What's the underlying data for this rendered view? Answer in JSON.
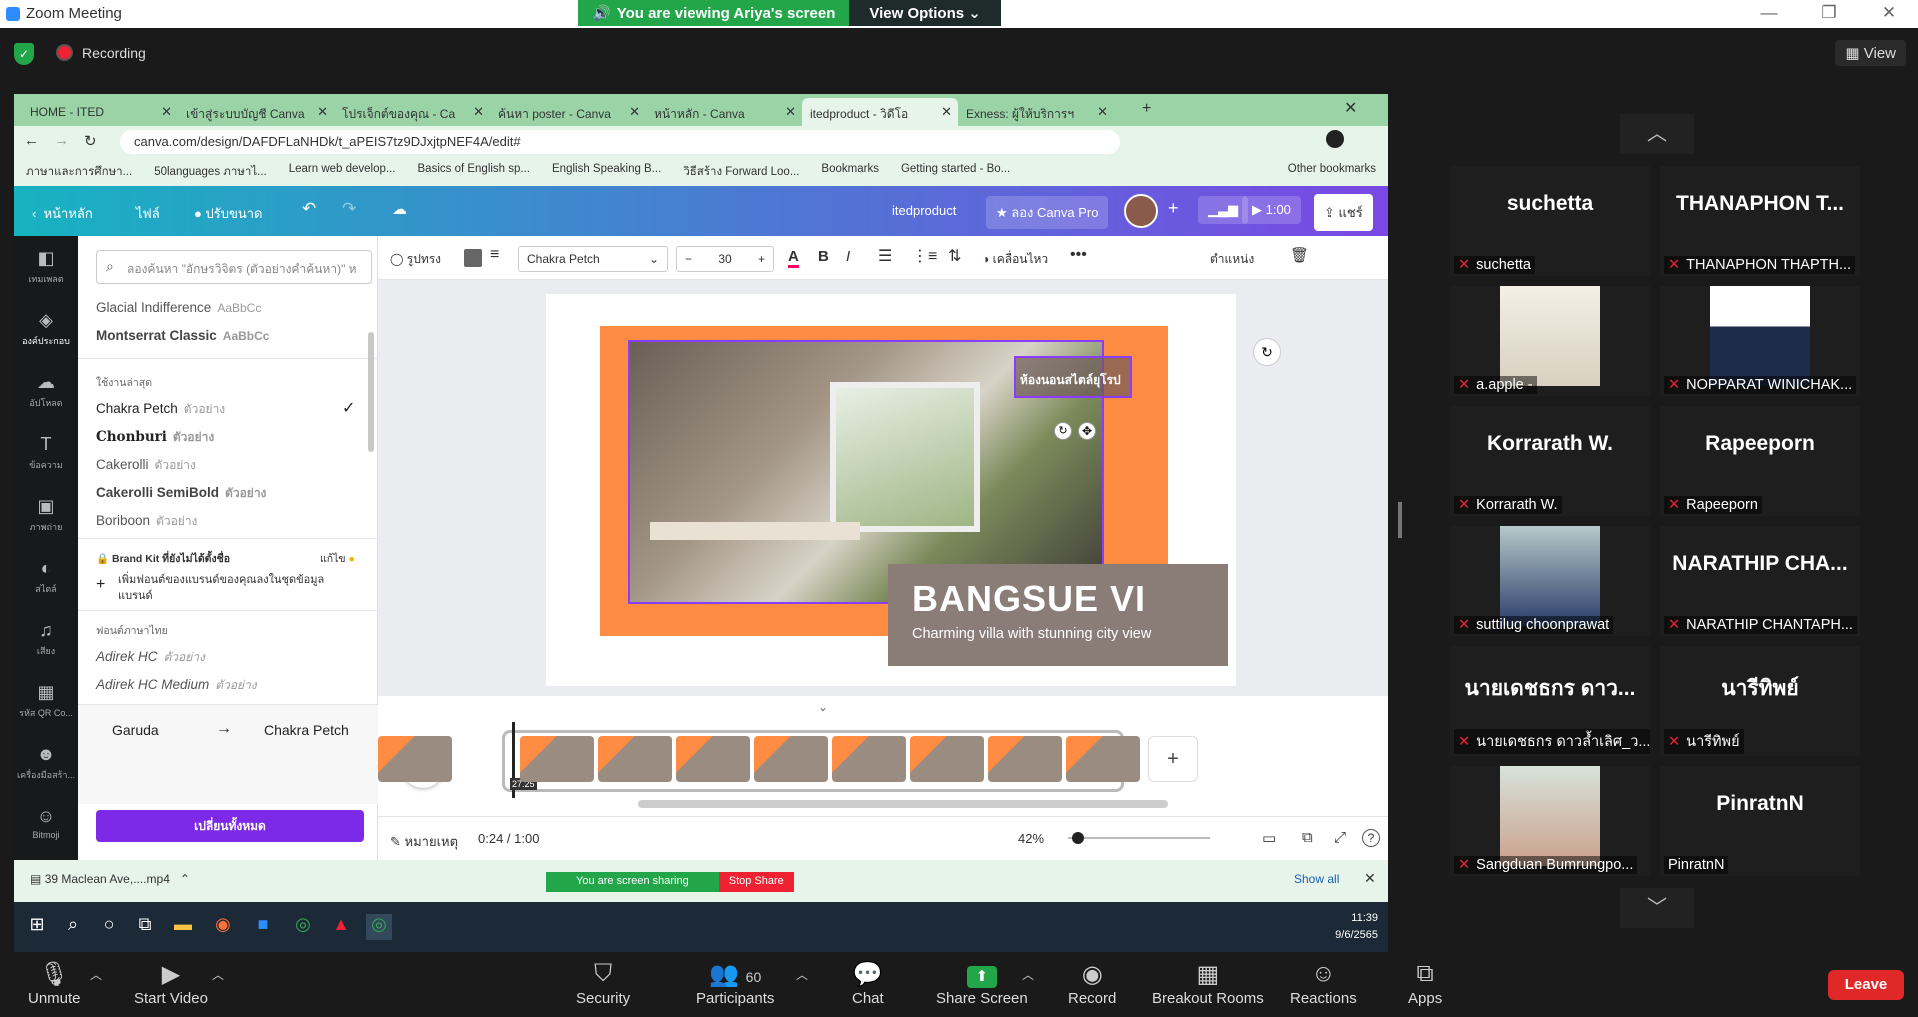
{
  "window": {
    "title": "Zoom Meeting"
  },
  "banner": {
    "viewing": "You are viewing Ariya's screen",
    "view_options": "View Options"
  },
  "meeting": {
    "recording": "Recording",
    "view": "View"
  },
  "browser": {
    "tabs": [
      "HOME - ITED",
      "เข้าสู่ระบบบัญชี Canva",
      "โปรเจ็กต์ของคุณ - Ca",
      "ค้นหา poster - Canva",
      "หน้าหลัก - Canva",
      "itedproduct - วิดีโอ",
      "Exness: ผู้ให้บริการฯ"
    ],
    "url": "canva.com/design/DAFDFLaNHDk/t_aPEIS7tz9DJxjtpNEF4A/edit#",
    "bookmarks": [
      "ภาษาและการศึกษา...",
      "50languages ภาษาไ...",
      "Learn web develop...",
      "Basics of English sp...",
      "English Speaking B...",
      "วิธีสร้าง Forward Loo...",
      "Bookmarks",
      "Getting started - Bo...",
      "Other bookmarks"
    ]
  },
  "canva": {
    "header": {
      "home": "หน้าหลัก",
      "file": "ไฟล์",
      "resize": "ปรับขนาด",
      "project": "itedproduct",
      "try_pro": "ลอง Canva Pro",
      "duration": "1:00",
      "share": "แชร์"
    },
    "rail": [
      "เทมเพลต",
      "องค์ประกอบ",
      "อัปโหลด",
      "ข้อความ",
      "ภาพถ่าย",
      "สไตล์",
      "เสียง",
      "รหัส QR Co...",
      "เครื่องมือสร้า...",
      "Bitmoji"
    ],
    "font_panel": {
      "search_placeholder": "ลองค้นหา \"อักษรวิจิตร (ตัวอย่างคำค้นหา)\" ห",
      "top_fonts": [
        {
          "name": "Glacial Indifference",
          "sample": "AaBbCc"
        },
        {
          "name": "Montserrat Classic",
          "sample": "AaBbCc"
        }
      ],
      "recent_label": "ใช้งานล่าสุด",
      "recent_fonts": [
        {
          "name": "Chakra Petch",
          "sample": "ตัวอย่าง"
        },
        {
          "name": "Chonburi",
          "sample": "ตัวอย่าง"
        },
        {
          "name": "Cakerolli",
          "sample": "ตัวอย่าง"
        },
        {
          "name": "Cakerolli SemiBold",
          "sample": "ตัวอย่าง"
        },
        {
          "name": "Boriboon",
          "sample": "ตัวอย่าง"
        }
      ],
      "brand_kit": "Brand Kit ที่ยังไม่ได้ตั้งชื่อ",
      "brand_edit": "แก้ไข",
      "brand_add": "เพิ่มฟอนต์ของแบรนด์ของคุณลงในชุดข้อมูลแบรนด์",
      "thai_label": "ฟอนต์ภาษาไทย",
      "thai_fonts": [
        {
          "name": "Adirek HC",
          "sample": "ตัวอย่าง"
        },
        {
          "name": "Adirek HC Medium",
          "sample": "ตัวอย่าง"
        }
      ],
      "replace_from": "Garuda",
      "replace_to": "Chakra Petch",
      "change_all": "เปลี่ยนทั้งหมด"
    },
    "toolbar": {
      "shape": "รูปทรง",
      "font": "Chakra Petch",
      "size": "30",
      "animate": "เคลื่อนไหว",
      "position": "ตำแหน่ง"
    },
    "design": {
      "label_text": "ห้องนอนสไตล์ยุโรป",
      "title": "BANGSUE VI",
      "tagline": "Charming villa with stunning city view"
    },
    "timeline": {
      "clip_time": "27.25"
    },
    "footer": {
      "notes": "หมายเหตุ",
      "time": "0:24 / 1:00",
      "zoom": "42%"
    }
  },
  "download": {
    "file": "39 Maclean Ave,....mp4",
    "show_all": "Show all"
  },
  "sharing": {
    "status": "You are screen sharing",
    "stop": "Stop Share"
  },
  "taskbar": {
    "time": "11:39",
    "date": "9/6/2565"
  },
  "participants": [
    {
      "tile": "suchetta",
      "label": "suchetta",
      "photo": false
    },
    {
      "tile": "THANAPHON T...",
      "label": "THANAPHON THAPTH...",
      "photo": false
    },
    {
      "tile": "",
      "label": "a.apple -",
      "photo": true
    },
    {
      "tile": "",
      "label": "NOPPARAT WINICHAK...",
      "photo": true
    },
    {
      "tile": "Korrarath W.",
      "label": "Korrarath W.",
      "photo": false
    },
    {
      "tile": "Rapeeporn",
      "label": "Rapeeporn",
      "photo": false
    },
    {
      "tile": "",
      "label": "suttilug choonprawat",
      "photo": true
    },
    {
      "tile": "NARATHIP CHA...",
      "label": "NARATHIP CHANTAPH...",
      "photo": false
    },
    {
      "tile": "นายเดชธกร ดาว...",
      "label": "นายเดชธกร ดาวล้ำเลิศ_ว...",
      "photo": false
    },
    {
      "tile": "นารีทิพย์",
      "label": "นารีทิพย์",
      "photo": false
    },
    {
      "tile": "",
      "label": "Sangduan Bumrungpo...",
      "photo": true
    },
    {
      "tile": "PinratnN",
      "label": "PinratnN",
      "photo": false
    }
  ],
  "controls": {
    "unmute": "Unmute",
    "start_video": "Start Video",
    "security": "Security",
    "participants": "Participants",
    "participant_count": "60",
    "chat": "Chat",
    "share_screen": "Share Screen",
    "record": "Record",
    "breakout": "Breakout Rooms",
    "reactions": "Reactions",
    "apps": "Apps",
    "leave": "Leave"
  }
}
